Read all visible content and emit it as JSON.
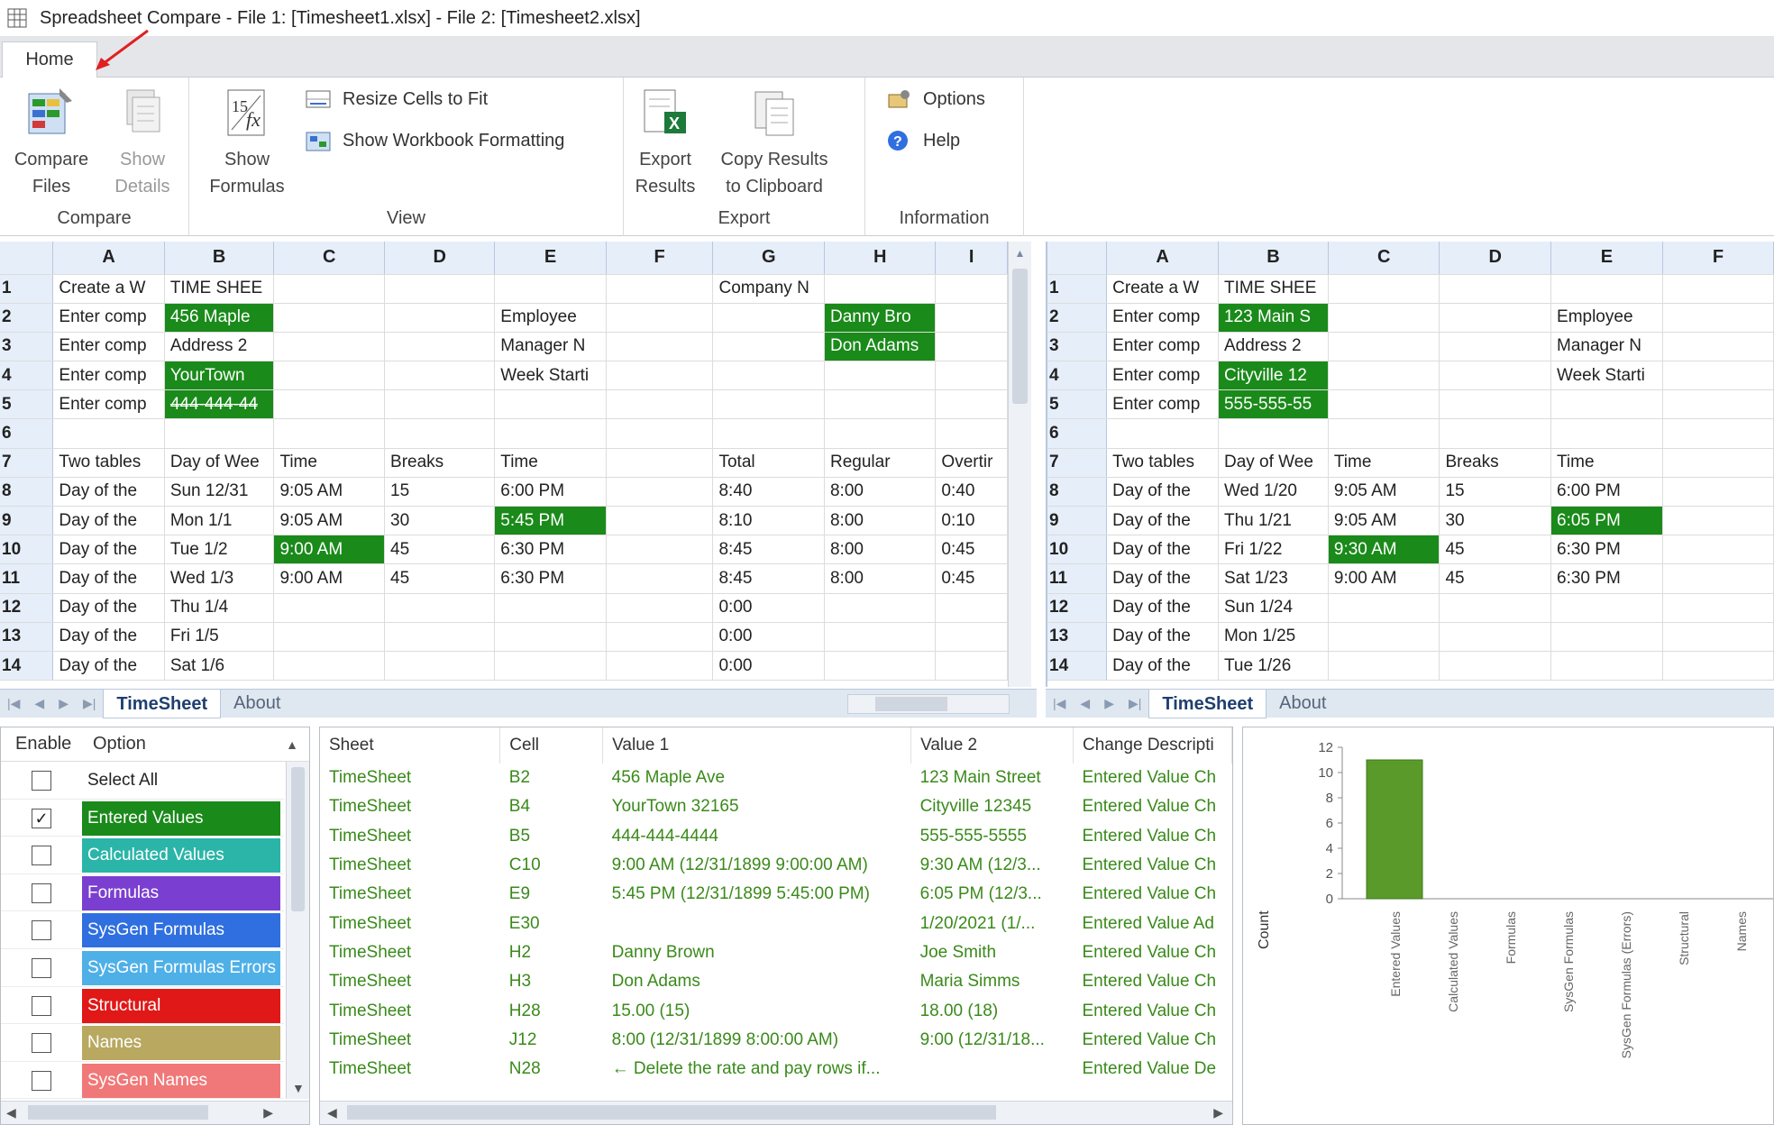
{
  "window": {
    "title": "Spreadsheet Compare - File 1: [Timesheet1.xlsx] - File 2: [Timesheet2.xlsx]"
  },
  "ribbon": {
    "tab": "Home",
    "groups": {
      "compare": {
        "label": "Compare",
        "compare_files": [
          "Compare",
          "Files"
        ],
        "show_details": [
          "Show",
          "Details"
        ]
      },
      "view": {
        "label": "View",
        "show_formulas": [
          "Show",
          "Formulas"
        ],
        "resize_cells": "Resize Cells to Fit",
        "show_workbook_formatting": "Show Workbook Formatting"
      },
      "export": {
        "label": "Export",
        "export_results": [
          "Export",
          "Results"
        ],
        "copy_results": [
          "Copy Results",
          "to Clipboard"
        ]
      },
      "information": {
        "label": "Information",
        "options": "Options",
        "help": "Help"
      }
    }
  },
  "left_sheet": {
    "columns": [
      "A",
      "B",
      "C",
      "D",
      "E",
      "F",
      "G",
      "H",
      "I"
    ],
    "rows": [
      {
        "n": "1",
        "cells": [
          "Create a W",
          "TIME SHEE",
          "",
          "",
          "",
          "",
          "Company N",
          "",
          ""
        ]
      },
      {
        "n": "2",
        "cells": [
          "Enter comp",
          "456 Maple",
          "",
          "",
          "Employee",
          "",
          "",
          "Danny Bro",
          ""
        ]
      },
      {
        "n": "3",
        "cells": [
          "Enter comp",
          "Address 2",
          "",
          "",
          "Manager N",
          "",
          "",
          "Don Adams",
          ""
        ]
      },
      {
        "n": "4",
        "cells": [
          "Enter comp",
          "YourTown",
          "",
          "",
          "Week Starti",
          "",
          "",
          "",
          ""
        ]
      },
      {
        "n": "5",
        "cells": [
          "Enter comp",
          "444-444-44",
          "",
          "",
          "",
          "",
          "",
          "",
          ""
        ]
      },
      {
        "n": "6",
        "cells": [
          "",
          "",
          "",
          "",
          "",
          "",
          "",
          "",
          ""
        ]
      },
      {
        "n": "7",
        "cells": [
          "Two tables",
          "Day of Wee",
          "Time",
          "Breaks",
          "Time",
          "",
          "Total",
          "Regular",
          "Overtir"
        ]
      },
      {
        "n": "8",
        "cells": [
          "Day of the",
          "Sun 12/31",
          "9:05 AM",
          "15",
          "6:00 PM",
          "",
          "8:40",
          "8:00",
          "0:40"
        ]
      },
      {
        "n": "9",
        "cells": [
          "Day of the",
          "Mon 1/1",
          "9:05 AM",
          "30",
          "5:45 PM",
          "",
          "8:10",
          "8:00",
          "0:10"
        ]
      },
      {
        "n": "10",
        "cells": [
          "Day of the",
          "Tue 1/2",
          "9:00 AM",
          "45",
          "6:30 PM",
          "",
          "8:45",
          "8:00",
          "0:45"
        ]
      },
      {
        "n": "11",
        "cells": [
          "Day of the",
          "Wed 1/3",
          "9:00 AM",
          "45",
          "6:30 PM",
          "",
          "8:45",
          "8:00",
          "0:45"
        ]
      },
      {
        "n": "12",
        "cells": [
          "Day of the",
          "Thu 1/4",
          "",
          "",
          "",
          "",
          "0:00",
          "",
          ""
        ]
      },
      {
        "n": "13",
        "cells": [
          "Day of the",
          "Fri 1/5",
          "",
          "",
          "",
          "",
          "0:00",
          "",
          ""
        ]
      },
      {
        "n": "14",
        "cells": [
          "Day of the",
          "Sat 1/6",
          "",
          "",
          "",
          "",
          "0:00",
          "",
          ""
        ]
      }
    ],
    "tabs": [
      "TimeSheet",
      "About"
    ]
  },
  "right_sheet": {
    "columns": [
      "A",
      "B",
      "C",
      "D",
      "E",
      "F"
    ],
    "rows": [
      {
        "n": "1",
        "cells": [
          "Create a W",
          "TIME SHEE",
          "",
          "",
          "",
          ""
        ]
      },
      {
        "n": "2",
        "cells": [
          "Enter comp",
          "123 Main S",
          "",
          "",
          "Employee",
          ""
        ]
      },
      {
        "n": "3",
        "cells": [
          "Enter comp",
          "Address 2",
          "",
          "",
          "Manager N",
          ""
        ]
      },
      {
        "n": "4",
        "cells": [
          "Enter comp",
          "Cityville 12",
          "",
          "",
          "Week Starti",
          ""
        ]
      },
      {
        "n": "5",
        "cells": [
          "Enter comp",
          "555-555-55",
          "",
          "",
          "",
          ""
        ]
      },
      {
        "n": "6",
        "cells": [
          "",
          "",
          "",
          "",
          "",
          ""
        ]
      },
      {
        "n": "7",
        "cells": [
          "Two tables",
          "Day of Wee",
          "Time",
          "Breaks",
          "Time",
          ""
        ]
      },
      {
        "n": "8",
        "cells": [
          "Day of the",
          "Wed 1/20",
          "9:05 AM",
          "15",
          "6:00 PM",
          ""
        ]
      },
      {
        "n": "9",
        "cells": [
          "Day of the",
          "Thu 1/21",
          "9:05 AM",
          "30",
          "6:05 PM",
          ""
        ]
      },
      {
        "n": "10",
        "cells": [
          "Day of the",
          "Fri 1/22",
          "9:30 AM",
          "45",
          "6:30 PM",
          ""
        ]
      },
      {
        "n": "11",
        "cells": [
          "Day of the",
          "Sat 1/23",
          "9:00 AM",
          "45",
          "6:30 PM",
          ""
        ]
      },
      {
        "n": "12",
        "cells": [
          "Day of the",
          "Sun 1/24",
          "",
          "",
          "",
          ""
        ]
      },
      {
        "n": "13",
        "cells": [
          "Day of the",
          "Mon 1/25",
          "",
          "",
          "",
          ""
        ]
      },
      {
        "n": "14",
        "cells": [
          "Day of the",
          "Tue 1/26",
          "",
          "",
          "",
          ""
        ]
      }
    ],
    "tabs": [
      "TimeSheet",
      "About"
    ]
  },
  "highlight_color": "#1a8a1a",
  "options_panel": {
    "headers": {
      "enable": "Enable",
      "option": "Option"
    },
    "items": [
      {
        "label": "Select All",
        "checked": false,
        "color": ""
      },
      {
        "label": "Entered Values",
        "checked": true,
        "color": "#1a8a1a"
      },
      {
        "label": "Calculated Values",
        "checked": false,
        "color": "#2bb5a8"
      },
      {
        "label": "Formulas",
        "checked": false,
        "color": "#7a3fd0"
      },
      {
        "label": "SysGen Formulas",
        "checked": false,
        "color": "#2f6fe0"
      },
      {
        "label": "SysGen Formulas Errors",
        "checked": false,
        "color": "#4fb0e8"
      },
      {
        "label": "Structural",
        "checked": false,
        "color": "#e01818"
      },
      {
        "label": "Names",
        "checked": false,
        "color": "#b8a860"
      },
      {
        "label": "SysGen Names",
        "checked": false,
        "color": "#f07878"
      }
    ]
  },
  "results": {
    "headers": [
      "Sheet",
      "Cell",
      "Value 1",
      "Value 2",
      "Change Descripti"
    ],
    "rows": [
      [
        "TimeSheet",
        "B2",
        "456 Maple Ave",
        "123 Main Street",
        "Entered Value Ch"
      ],
      [
        "TimeSheet",
        "B4",
        "YourTown 32165",
        "Cityville 12345",
        "Entered Value Ch"
      ],
      [
        "TimeSheet",
        "B5",
        "444-444-4444",
        "555-555-5555",
        "Entered Value Ch"
      ],
      [
        "TimeSheet",
        "C10",
        "9:00 AM (12/31/1899 9:00:00 AM)",
        "9:30 AM (12/3...",
        "Entered Value Ch"
      ],
      [
        "TimeSheet",
        "E9",
        "5:45 PM (12/31/1899 5:45:00 PM)",
        "6:05 PM (12/3...",
        "Entered Value Ch"
      ],
      [
        "TimeSheet",
        "E30",
        "",
        "1/20/2021 (1/...",
        "Entered Value Ad"
      ],
      [
        "TimeSheet",
        "H2",
        "Danny Brown",
        "Joe Smith",
        "Entered Value Ch"
      ],
      [
        "TimeSheet",
        "H3",
        "Don Adams",
        "Maria Simms",
        "Entered Value Ch"
      ],
      [
        "TimeSheet",
        "H28",
        "15.00  (15)",
        "18.00  (18)",
        "Entered Value Ch"
      ],
      [
        "TimeSheet",
        "J12",
        "8:00 (12/31/1899 8:00:00 AM)",
        "9:00 (12/31/18...",
        "Entered Value Ch"
      ],
      [
        "TimeSheet",
        "N28",
        "← Delete the rate and pay rows if...",
        "",
        "Entered Value De"
      ]
    ]
  },
  "chart_data": {
    "type": "bar",
    "categories": [
      "Entered Values",
      "Calculated Values",
      "Formulas",
      "SysGen Formulas",
      "SysGen Formulas (Errors)",
      "Structural",
      "Names"
    ],
    "values": [
      11,
      0,
      0,
      0,
      0,
      0,
      0
    ],
    "ylabel": "Count",
    "ylim": [
      0,
      12
    ],
    "yticks": [
      "12",
      "10",
      "8",
      "6",
      "4",
      "2",
      "0"
    ],
    "bar_color": "#5a9a2a"
  }
}
